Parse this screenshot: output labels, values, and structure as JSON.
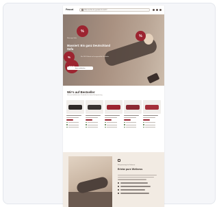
{
  "header": {
    "logo": "Pascal",
    "search_placeholder": "Was suchst du gerade für dich?"
  },
  "hero": {
    "badge_1": "%",
    "badge_2": "%",
    "badge_3": "%",
    "badge_4": "SALE",
    "kicker": "Massage-Sale",
    "title": "Massiert: Bis ganz Deutschland Sofa",
    "subtitle": "Bis 30% Rabatt auf ausgewählte Produkte",
    "button": "Jetzt entdecken"
  },
  "bestsellers": {
    "title": "Wir's auf Bestseller",
    "subtitle": "Unsere beliebtesten Produkte für deine Entspannung",
    "products": [
      {
        "color": "#2f2a28"
      },
      {
        "color": "#3a3432"
      },
      {
        "color": "#9c2430"
      },
      {
        "color": "#8c2a33"
      },
      {
        "color": "#a5303a"
      }
    ]
  },
  "promo": {
    "kicker": "Entspannung für Zuhause",
    "title": "Erlebe pure Wellness"
  },
  "colors": {
    "accent": "#9c2430",
    "hero_bg": "#a99181",
    "promo_bg": "#f2ebe3"
  }
}
